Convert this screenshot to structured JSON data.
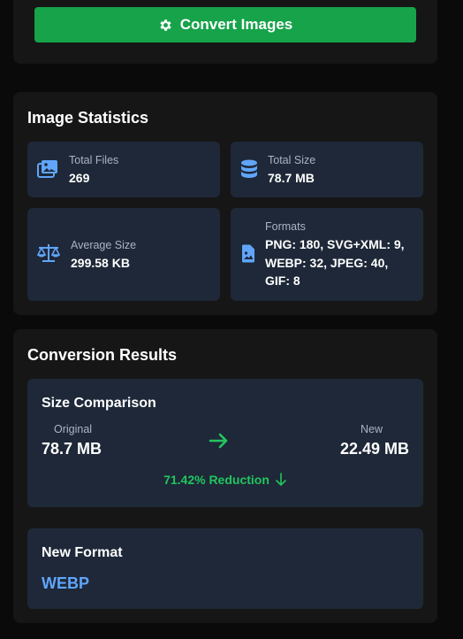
{
  "convert": {
    "label": "Convert Images"
  },
  "stats": {
    "title": "Image Statistics",
    "total_files": {
      "label": "Total Files",
      "value": "269"
    },
    "total_size": {
      "label": "Total Size",
      "value": "78.7 MB"
    },
    "average_size": {
      "label": "Average Size",
      "value": "299.58 KB"
    },
    "formats": {
      "label": "Formats",
      "lines": [
        "PNG: 180, SVG+XML: 9,",
        "WEBP: 32, JPEG: 40,",
        "GIF: 8"
      ]
    }
  },
  "results": {
    "title": "Conversion Results",
    "comparison": {
      "title": "Size Comparison",
      "original_label": "Original",
      "original_value": "78.7 MB",
      "new_label": "New",
      "new_value": "22.49 MB",
      "reduction": "71.42% Reduction"
    },
    "new_format": {
      "title": "New Format",
      "value": "WEBP"
    }
  },
  "colors": {
    "accent_green": "#16a34a",
    "success_text": "#22c55e",
    "icon_blue": "#60a5fa",
    "card_bg": "#1e2838"
  }
}
